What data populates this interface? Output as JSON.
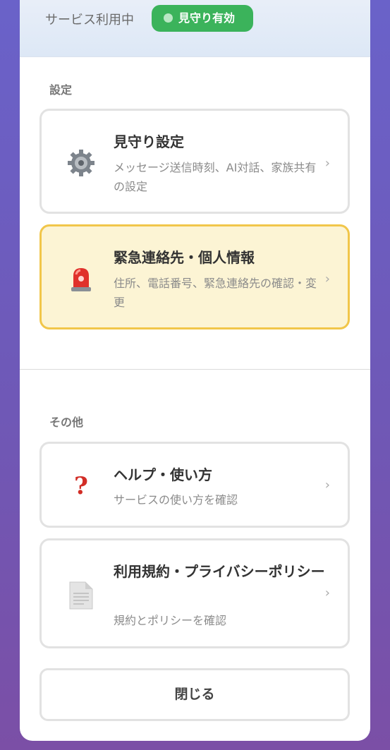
{
  "status": {
    "label": "サービス利用中",
    "badge": "見守り有効"
  },
  "sections": {
    "settings": "設定",
    "other": "その他"
  },
  "items": {
    "watch": {
      "title": "見守り設定",
      "desc": "メッセージ送信時刻、AI対話、家族共有の設定",
      "icon": "gear-icon"
    },
    "emergency": {
      "title": "緊急連絡先・個人情報",
      "desc": "住所、電話番号、緊急連絡先の確認・変更",
      "icon": "siren-icon"
    },
    "help": {
      "title": "ヘルプ・使い方",
      "desc": "サービスの使い方を確認",
      "icon": "question-icon"
    },
    "terms": {
      "title": "利用規約・プライバシーポリシー",
      "desc": "規約とポリシーを確認",
      "icon": "document-icon"
    }
  },
  "close_label": "閉じる",
  "chevron": "›",
  "colors": {
    "badge": "#3bb35b",
    "highlight_bg": "#fcf4d4",
    "highlight_border": "#f1c64a"
  }
}
